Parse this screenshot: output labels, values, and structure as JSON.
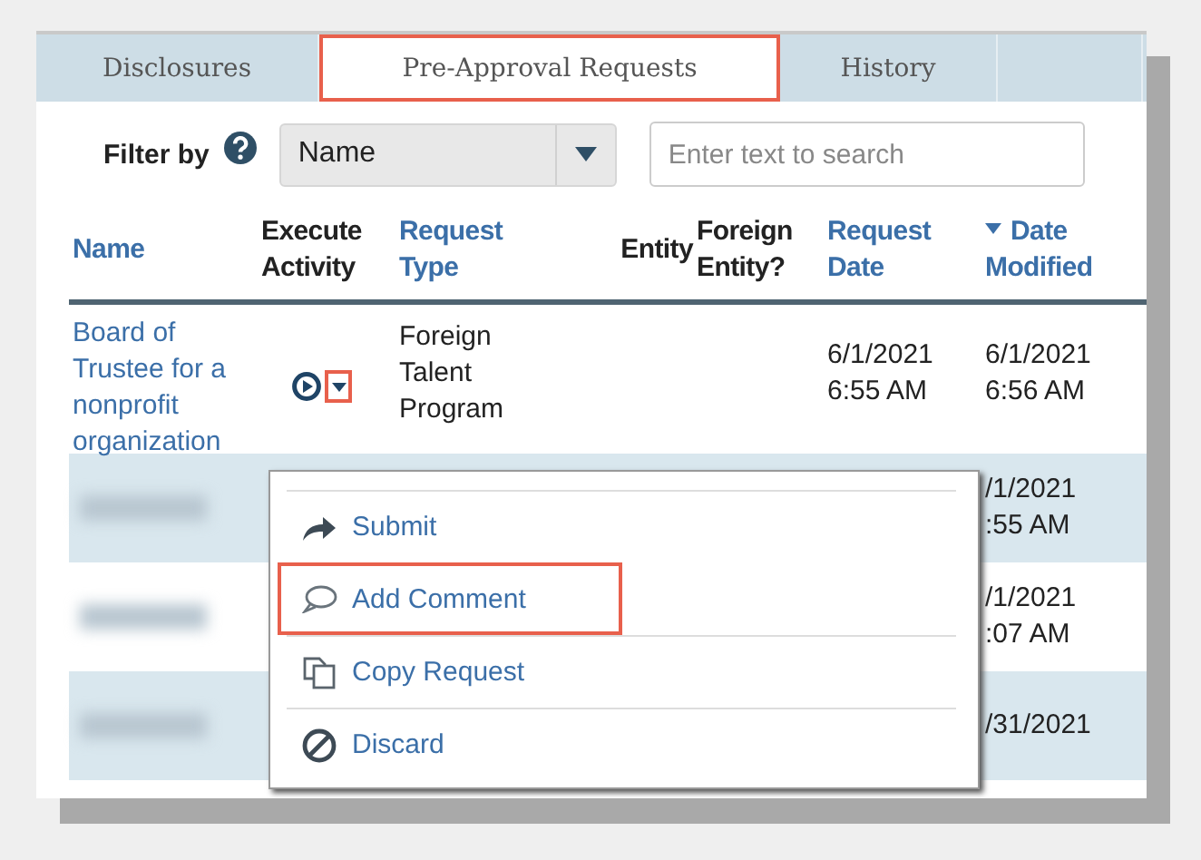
{
  "tabs": [
    {
      "label": "Disclosures",
      "selected": false,
      "highlighted": false
    },
    {
      "label": "Pre-Approval Requests",
      "selected": true,
      "highlighted": true
    },
    {
      "label": "History",
      "selected": false,
      "highlighted": false
    }
  ],
  "filter": {
    "label": "Filter by",
    "select_value": "Name",
    "search_placeholder": "Enter text to search"
  },
  "table": {
    "columns": [
      {
        "label": "Name",
        "sortable": true,
        "sorted": false
      },
      {
        "label": "Execute Activity",
        "sortable": false,
        "sorted": false
      },
      {
        "label": "Request Type",
        "sortable": true,
        "sorted": false
      },
      {
        "label": "Entity",
        "sortable": false,
        "sorted": false
      },
      {
        "label": "Foreign Entity?",
        "sortable": false,
        "sorted": false
      },
      {
        "label": "Request Date",
        "sortable": true,
        "sorted": false
      },
      {
        "label": "Date Modified",
        "sortable": true,
        "sorted": true
      }
    ],
    "rows": [
      {
        "name": "Board of Trustee for a nonprofit organization",
        "redacted": false,
        "caret_highlighted": true,
        "request_type": "Foreign Talent Program",
        "request_date": "6/1/2021 6:55 AM",
        "date_modified": "6/1/2021 6:56 AM"
      },
      {
        "redacted": true,
        "date_modified": "/1/2021 :55 AM"
      },
      {
        "redacted": true,
        "date_modified": "/1/2021 :07 AM"
      },
      {
        "redacted": true,
        "date_modified": "/31/2021"
      }
    ]
  },
  "menu": {
    "items": [
      {
        "label": "Submit",
        "highlighted": false
      },
      {
        "label": "Add Comment",
        "highlighted": true
      },
      {
        "label": "Copy Request",
        "highlighted": false
      },
      {
        "label": "Discard",
        "highlighted": false
      }
    ]
  }
}
